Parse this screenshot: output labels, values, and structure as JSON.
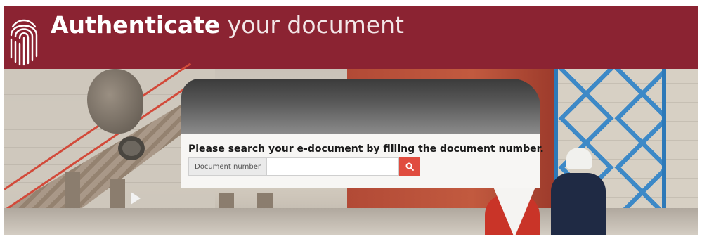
{
  "header": {
    "title_bold": "Authenticate",
    "title_light": " your document",
    "logo_icon": "fingerprint-icon",
    "background_color": "#8b2332"
  },
  "search": {
    "prompt": "Please search your e-document by filling the document number.",
    "label": "Document number",
    "value": "",
    "placeholder": "",
    "button_icon": "search-icon",
    "button_color": "#e04c3f"
  }
}
